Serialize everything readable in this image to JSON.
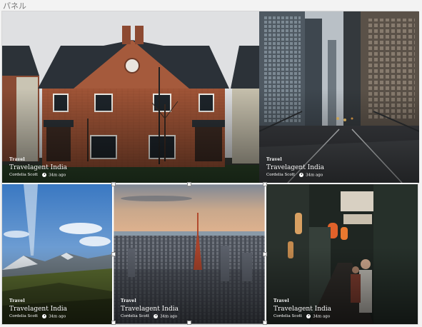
{
  "panel": {
    "label": "パネル"
  },
  "tiles": [
    {
      "category": "Travel",
      "title": "Travelagent India",
      "author": "Cordelia Scott",
      "time": "34m ago"
    },
    {
      "category": "Travel",
      "title": "Travelagent India",
      "author": "Cordelia Scott",
      "time": "34m ago"
    },
    {
      "category": "Travel",
      "title": "Travelagent India",
      "author": "Cordelia Scott",
      "time": "34m ago"
    },
    {
      "category": "Travel",
      "title": "Travelagent India",
      "author": "Cordelia Scott",
      "time": "34m ago"
    },
    {
      "category": "Travel",
      "title": "Travelagent India",
      "author": "Cordelia Scott",
      "time": "34m ago"
    }
  ],
  "icons": {
    "time": "clock-icon"
  }
}
